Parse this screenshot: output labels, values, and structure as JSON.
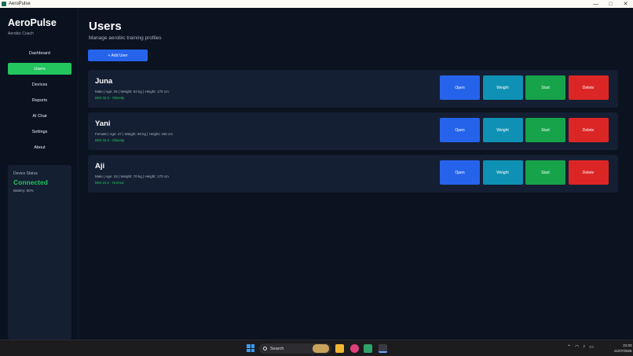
{
  "window": {
    "title": "AeroPulse",
    "minimize": "—",
    "maximize": "□",
    "close": "✕"
  },
  "sidebar": {
    "brand": "AeroPulse",
    "subtitle": "Aerobic Coach",
    "items": [
      {
        "label": "Dashboard",
        "active": false
      },
      {
        "label": "Users",
        "active": true
      },
      {
        "label": "Devices",
        "active": false
      },
      {
        "label": "Reports",
        "active": false
      },
      {
        "label": "AI Chat",
        "active": false
      },
      {
        "label": "Settings",
        "active": false
      },
      {
        "label": "About",
        "active": false
      }
    ],
    "device": {
      "title": "Device Status",
      "status": "Connected",
      "battery": "Battery: 80%"
    }
  },
  "main": {
    "title": "Users",
    "subtitle": "Manage aerobic training profiles",
    "add_label": "+ Add User",
    "actions": {
      "open": "Open",
      "weight": "Weight",
      "start": "Start",
      "delete": "Delete"
    },
    "users": [
      {
        "name": "Juna",
        "info": "Male | Age: 25 | Weight: 94 kg | Height: 170 cm",
        "bmi": "BMI 32.5 - Obesity"
      },
      {
        "name": "Yani",
        "info": "Female | Age: 47 | Weight: 80 kg | Height: 155 cm",
        "bmi": "BMI 33.3 - Obesity"
      },
      {
        "name": "Aji",
        "info": "Male | Age: 19 | Weight: 70 kg | Height: 170 cm",
        "bmi": "BMI 24.2 - Normal"
      }
    ]
  },
  "taskbar": {
    "search_label": "Search",
    "time": "21:03",
    "date": "21/07/2026"
  },
  "colors": {
    "accent_green": "#22c55e",
    "primary_blue": "#2563eb",
    "teal": "#0e91b4",
    "danger_red": "#dc2626"
  }
}
